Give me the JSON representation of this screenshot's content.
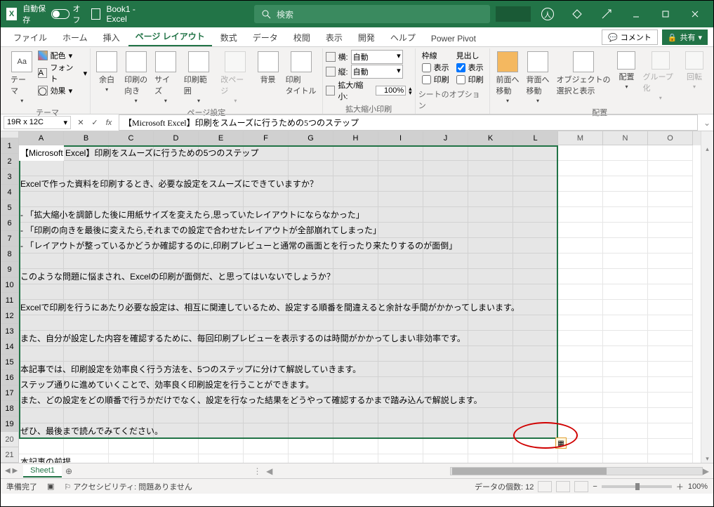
{
  "title": {
    "autosave_label": "自動保存",
    "autosave_state": "オフ",
    "filename": "Book1 - Excel",
    "search_placeholder": "検索"
  },
  "tabs": {
    "file": "ファイル",
    "home": "ホーム",
    "insert": "挿入",
    "pagelayout": "ページ レイアウト",
    "formulas": "数式",
    "data": "データ",
    "review": "校閲",
    "view": "表示",
    "developer": "開発",
    "help": "ヘルプ",
    "powerpivot": "Power Pivot",
    "comments": "コメント",
    "share": "共有"
  },
  "ribbon": {
    "themes": {
      "group": "テーマ",
      "theme": "テーマ",
      "colors": "配色",
      "fonts": "フォント",
      "effects": "効果"
    },
    "pagesetup": {
      "group": "ページ設定",
      "margins": "余白",
      "orientation": "印刷の\n向き",
      "size": "サイズ",
      "printarea": "印刷範囲",
      "breaks": "改ページ",
      "background": "背景",
      "titles": "印刷\nタイトル"
    },
    "scale": {
      "group": "拡大縮小印刷",
      "width": "横:",
      "height": "縦:",
      "auto": "自動",
      "scale": "拡大/縮小:",
      "scaleval": "100%"
    },
    "sheet": {
      "group": "シートのオプション",
      "gridlines": "枠線",
      "headings": "見出し",
      "view": "表示",
      "print": "印刷"
    },
    "arrange": {
      "group": "配置",
      "front": "前面へ\n移動",
      "back": "背面へ\n移動",
      "selection": "オブジェクトの\n選択と表示",
      "align": "配置",
      "group_cmd": "グループ化",
      "rotate": "回転"
    }
  },
  "formula": {
    "namebox": "19R x 12C",
    "value": "【Microsoft Excel】印刷をスムーズに行うための5つのステップ"
  },
  "columns": [
    "A",
    "B",
    "C",
    "D",
    "E",
    "F",
    "G",
    "H",
    "I",
    "J",
    "K",
    "L",
    "M",
    "N",
    "O"
  ],
  "rows": [
    "1",
    "2",
    "3",
    "4",
    "5",
    "6",
    "7",
    "8",
    "9",
    "10",
    "11",
    "12",
    "13",
    "14",
    "15",
    "16",
    "17",
    "18",
    "19",
    "20",
    "21"
  ],
  "celltext": {
    "r1": "【Microsoft Excel】印刷をスムーズに行うための5つのステップ",
    "r3": "Excelで作った資料を印刷するとき、必要な設定をスムーズにできていますか？",
    "r5": "- 「拡大縮小を調節した後に用紙サイズを変えたら,思っていたレイアウトにならなかった」",
    "r6": "- 「印刷の向きを最後に変えたら,それまでの設定で合わせたレイアウトが全部崩れてしまった」",
    "r7": "- 「レイアウトが整っているかどうか確認するのに,印刷プレビューと通常の画面とを行ったり来たりするのが面倒」",
    "r9": "このような問題に悩まされ、Excelの印刷が面倒だ、と思ってはいないでしょうか？",
    "r11": "Excelで印刷を行うにあたり必要な設定は、相互に関連しているため、設定する順番を間違えると余計な手間がかかってしまいます。",
    "r13": "また、自分が設定した内容を確認するために、毎回印刷プレビューを表示するのは時間がかかってしまい非効率です。",
    "r15": "本記事では、印刷設定を効率良く行う方法を、5つのステップに分けて解説していきます。",
    "r16": "ステップ通りに進めていくことで、効率良く印刷設定を行うことができます。",
    "r17": "また、どの設定をどの順番で行うかだけでなく、設定を行なった結果をどうやって確認するかまで踏み込んで解説します。",
    "r19": "ぜひ、最後まで読んでみてください。",
    "r21": "本記事の前提"
  },
  "sheet": {
    "active": "Sheet1"
  },
  "status": {
    "ready": "準備完了",
    "accessibility": "アクセシビリティ: 問題ありません",
    "count_label": "データの個数:",
    "count": "12",
    "zoom": "100%"
  }
}
